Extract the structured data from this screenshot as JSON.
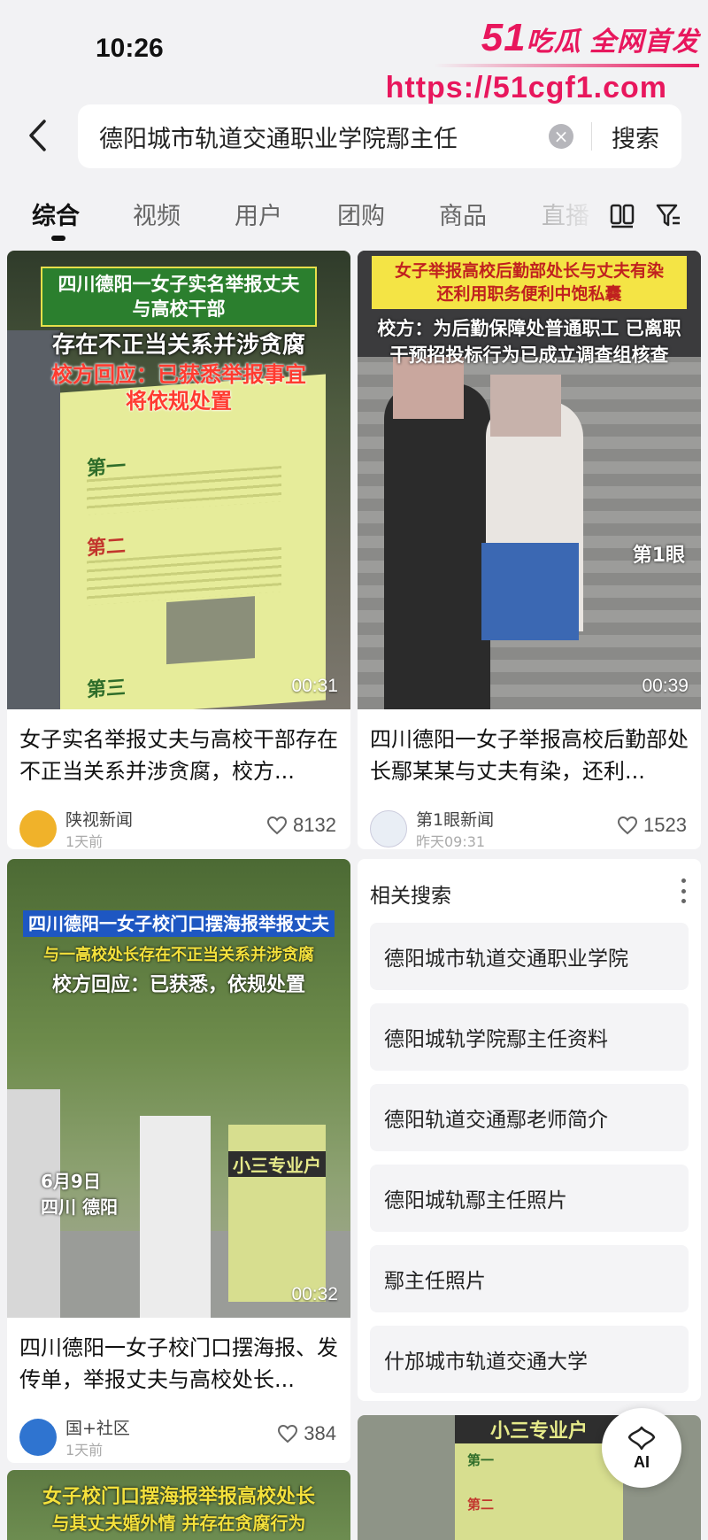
{
  "status": {
    "time": "10:26"
  },
  "watermark": {
    "line1_num": "51",
    "line1_text": "吃瓜 全网首发",
    "line2": "https://51cgf1.com"
  },
  "search": {
    "query": "德阳城市轨道交通职业学院鄢主任",
    "submit_label": "搜索"
  },
  "tabs": [
    {
      "label": "综合",
      "active": true
    },
    {
      "label": "视频"
    },
    {
      "label": "用户"
    },
    {
      "label": "团购"
    },
    {
      "label": "商品"
    },
    {
      "label": "直播"
    }
  ],
  "icons": [
    "back-arrow-icon",
    "clear-icon",
    "grid-view-icon",
    "filter-icon",
    "heart-icon",
    "ai-assistant-icon"
  ],
  "cards": [
    {
      "overlay": [
        "四川德阳一女子实名举报丈夫",
        "与高校干部",
        "存在不正当关系并涉贪腐",
        "校方回应：已获悉举报事宜",
        "将依规处置"
      ],
      "poster_text": [
        "第一",
        "第二",
        "第三"
      ],
      "duration": "00:31",
      "title": "女子实名举报丈夫与高校干部存在不正当关系并涉贪腐，校方...",
      "source": "陕视新闻",
      "time": "1天前",
      "likes": "8132"
    },
    {
      "overlay": [
        "女子举报高校后勤部处长与丈夫有染",
        "还利用职务便利中饱私囊",
        "校方：为后勤保障处普通职工 已离职",
        "干预招投标行为已成立调查组核查"
      ],
      "watermark": "第1眼",
      "duration": "00:39",
      "title": "四川德阳一女子举报高校后勤部处长鄢某某与丈夫有染，还利...",
      "source": "第1眼新闻",
      "time": "昨天09:31",
      "likes": "1523"
    },
    {
      "overlay": [
        "四川德阳一女子校门口摆海报举报丈夫",
        "与一高校处长存在不正当关系并涉贪腐",
        "校方回应：已获悉，依规处置"
      ],
      "date_label": [
        "6月9日",
        "四川 德阳"
      ],
      "poster_text": "小三专业户",
      "duration": "00:32",
      "title": "四川德阳一女子校门口摆海报、发传单，举报丈夫与高校处长...",
      "source": "国+社区",
      "time": "1天前",
      "likes": "384"
    },
    {
      "overlay": [
        "女子校门口摆海报举报高校处长",
        "与其丈夫婚外情 并存在贪腐行为"
      ]
    },
    {
      "poster_text": [
        "小三专业户",
        "第一",
        "第二"
      ]
    }
  ],
  "related": {
    "title": "相关搜索",
    "items": [
      "德阳城市轨道交通职业学院",
      "德阳城轨学院鄢主任资料",
      "德阳轨道交通鄢老师简介",
      "德阳城轨鄢主任照片",
      "鄢主任照片",
      "什邡城市轨道交通大学"
    ]
  },
  "ai_button": {
    "label": "AI"
  },
  "colors": {
    "accent": "#e8175d",
    "background": "#f2f2f4",
    "card": "#ffffff"
  }
}
